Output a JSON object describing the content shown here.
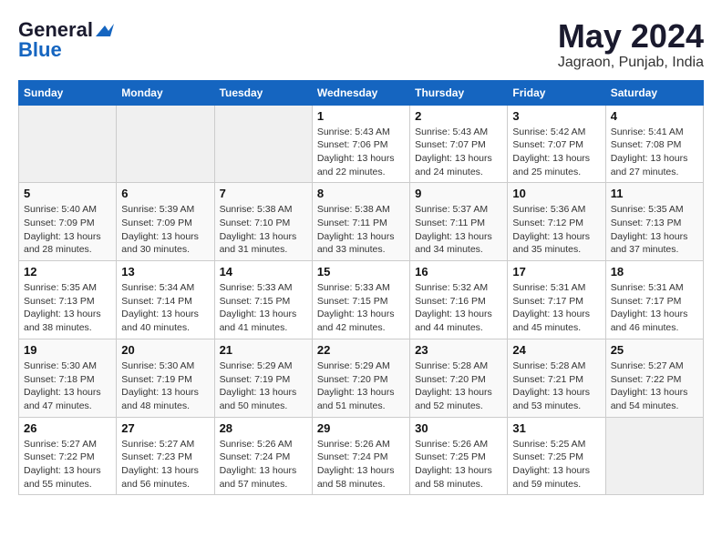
{
  "header": {
    "logo_general": "General",
    "logo_blue": "Blue",
    "month": "May 2024",
    "location": "Jagraon, Punjab, India"
  },
  "weekdays": [
    "Sunday",
    "Monday",
    "Tuesday",
    "Wednesday",
    "Thursday",
    "Friday",
    "Saturday"
  ],
  "weeks": [
    [
      {
        "day": "",
        "info": ""
      },
      {
        "day": "",
        "info": ""
      },
      {
        "day": "",
        "info": ""
      },
      {
        "day": "1",
        "sunrise": "Sunrise: 5:43 AM",
        "sunset": "Sunset: 7:06 PM",
        "daylight": "Daylight: 13 hours and 22 minutes."
      },
      {
        "day": "2",
        "sunrise": "Sunrise: 5:43 AM",
        "sunset": "Sunset: 7:07 PM",
        "daylight": "Daylight: 13 hours and 24 minutes."
      },
      {
        "day": "3",
        "sunrise": "Sunrise: 5:42 AM",
        "sunset": "Sunset: 7:07 PM",
        "daylight": "Daylight: 13 hours and 25 minutes."
      },
      {
        "day": "4",
        "sunrise": "Sunrise: 5:41 AM",
        "sunset": "Sunset: 7:08 PM",
        "daylight": "Daylight: 13 hours and 27 minutes."
      }
    ],
    [
      {
        "day": "5",
        "sunrise": "Sunrise: 5:40 AM",
        "sunset": "Sunset: 7:09 PM",
        "daylight": "Daylight: 13 hours and 28 minutes."
      },
      {
        "day": "6",
        "sunrise": "Sunrise: 5:39 AM",
        "sunset": "Sunset: 7:09 PM",
        "daylight": "Daylight: 13 hours and 30 minutes."
      },
      {
        "day": "7",
        "sunrise": "Sunrise: 5:38 AM",
        "sunset": "Sunset: 7:10 PM",
        "daylight": "Daylight: 13 hours and 31 minutes."
      },
      {
        "day": "8",
        "sunrise": "Sunrise: 5:38 AM",
        "sunset": "Sunset: 7:11 PM",
        "daylight": "Daylight: 13 hours and 33 minutes."
      },
      {
        "day": "9",
        "sunrise": "Sunrise: 5:37 AM",
        "sunset": "Sunset: 7:11 PM",
        "daylight": "Daylight: 13 hours and 34 minutes."
      },
      {
        "day": "10",
        "sunrise": "Sunrise: 5:36 AM",
        "sunset": "Sunset: 7:12 PM",
        "daylight": "Daylight: 13 hours and 35 minutes."
      },
      {
        "day": "11",
        "sunrise": "Sunrise: 5:35 AM",
        "sunset": "Sunset: 7:13 PM",
        "daylight": "Daylight: 13 hours and 37 minutes."
      }
    ],
    [
      {
        "day": "12",
        "sunrise": "Sunrise: 5:35 AM",
        "sunset": "Sunset: 7:13 PM",
        "daylight": "Daylight: 13 hours and 38 minutes."
      },
      {
        "day": "13",
        "sunrise": "Sunrise: 5:34 AM",
        "sunset": "Sunset: 7:14 PM",
        "daylight": "Daylight: 13 hours and 40 minutes."
      },
      {
        "day": "14",
        "sunrise": "Sunrise: 5:33 AM",
        "sunset": "Sunset: 7:15 PM",
        "daylight": "Daylight: 13 hours and 41 minutes."
      },
      {
        "day": "15",
        "sunrise": "Sunrise: 5:33 AM",
        "sunset": "Sunset: 7:15 PM",
        "daylight": "Daylight: 13 hours and 42 minutes."
      },
      {
        "day": "16",
        "sunrise": "Sunrise: 5:32 AM",
        "sunset": "Sunset: 7:16 PM",
        "daylight": "Daylight: 13 hours and 44 minutes."
      },
      {
        "day": "17",
        "sunrise": "Sunrise: 5:31 AM",
        "sunset": "Sunset: 7:17 PM",
        "daylight": "Daylight: 13 hours and 45 minutes."
      },
      {
        "day": "18",
        "sunrise": "Sunrise: 5:31 AM",
        "sunset": "Sunset: 7:17 PM",
        "daylight": "Daylight: 13 hours and 46 minutes."
      }
    ],
    [
      {
        "day": "19",
        "sunrise": "Sunrise: 5:30 AM",
        "sunset": "Sunset: 7:18 PM",
        "daylight": "Daylight: 13 hours and 47 minutes."
      },
      {
        "day": "20",
        "sunrise": "Sunrise: 5:30 AM",
        "sunset": "Sunset: 7:19 PM",
        "daylight": "Daylight: 13 hours and 48 minutes."
      },
      {
        "day": "21",
        "sunrise": "Sunrise: 5:29 AM",
        "sunset": "Sunset: 7:19 PM",
        "daylight": "Daylight: 13 hours and 50 minutes."
      },
      {
        "day": "22",
        "sunrise": "Sunrise: 5:29 AM",
        "sunset": "Sunset: 7:20 PM",
        "daylight": "Daylight: 13 hours and 51 minutes."
      },
      {
        "day": "23",
        "sunrise": "Sunrise: 5:28 AM",
        "sunset": "Sunset: 7:20 PM",
        "daylight": "Daylight: 13 hours and 52 minutes."
      },
      {
        "day": "24",
        "sunrise": "Sunrise: 5:28 AM",
        "sunset": "Sunset: 7:21 PM",
        "daylight": "Daylight: 13 hours and 53 minutes."
      },
      {
        "day": "25",
        "sunrise": "Sunrise: 5:27 AM",
        "sunset": "Sunset: 7:22 PM",
        "daylight": "Daylight: 13 hours and 54 minutes."
      }
    ],
    [
      {
        "day": "26",
        "sunrise": "Sunrise: 5:27 AM",
        "sunset": "Sunset: 7:22 PM",
        "daylight": "Daylight: 13 hours and 55 minutes."
      },
      {
        "day": "27",
        "sunrise": "Sunrise: 5:27 AM",
        "sunset": "Sunset: 7:23 PM",
        "daylight": "Daylight: 13 hours and 56 minutes."
      },
      {
        "day": "28",
        "sunrise": "Sunrise: 5:26 AM",
        "sunset": "Sunset: 7:24 PM",
        "daylight": "Daylight: 13 hours and 57 minutes."
      },
      {
        "day": "29",
        "sunrise": "Sunrise: 5:26 AM",
        "sunset": "Sunset: 7:24 PM",
        "daylight": "Daylight: 13 hours and 58 minutes."
      },
      {
        "day": "30",
        "sunrise": "Sunrise: 5:26 AM",
        "sunset": "Sunset: 7:25 PM",
        "daylight": "Daylight: 13 hours and 58 minutes."
      },
      {
        "day": "31",
        "sunrise": "Sunrise: 5:25 AM",
        "sunset": "Sunset: 7:25 PM",
        "daylight": "Daylight: 13 hours and 59 minutes."
      },
      {
        "day": "",
        "info": ""
      }
    ]
  ]
}
